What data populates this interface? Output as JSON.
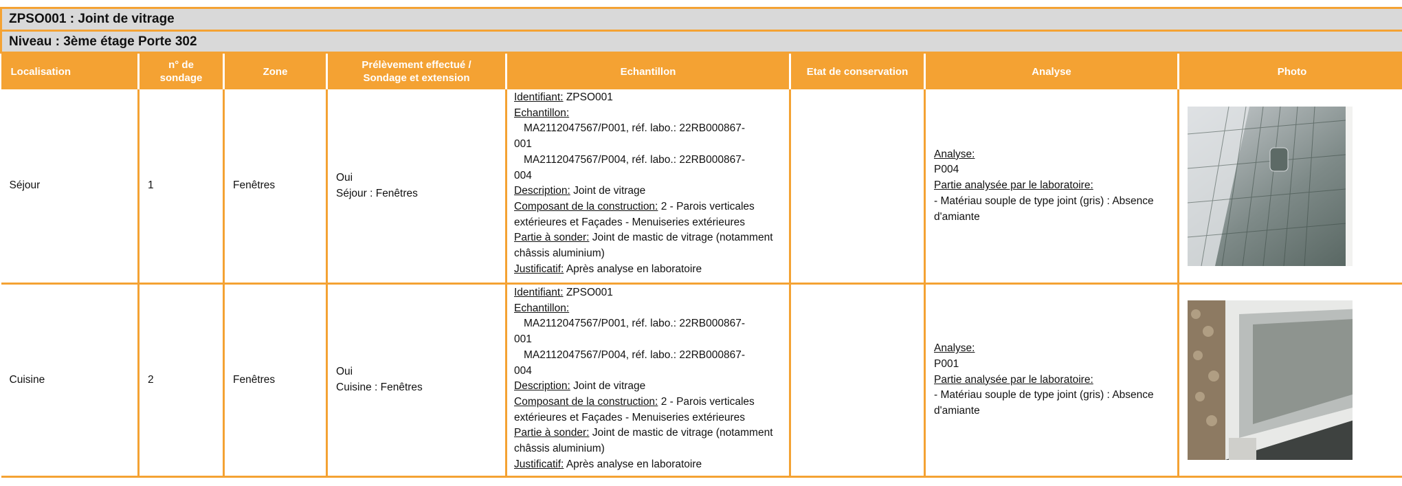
{
  "title": "ZPSO001 : Joint de vitrage",
  "level": "Niveau : 3ème étage Porte 302",
  "columns": {
    "localisation": "Localisation",
    "sondage": "n° de sondage",
    "zone": "Zone",
    "prelevement": "Prélèvement effectué / Sondage et extension",
    "echantillon": "Echantillon",
    "etat": "Etat de conservation",
    "analyse": "Analyse",
    "photo": "Photo"
  },
  "labels": {
    "identifiant": "Identifiant:",
    "echantillon": "Echantillon:",
    "description": "Description:",
    "composant": "Composant de la construction:",
    "partie": "Partie à sonder:",
    "justificatif": "Justificatif:",
    "analyse": "Analyse:",
    "partie_analysee": "Partie analysée par le laboratoire:"
  },
  "rows": [
    {
      "localisation": "Séjour",
      "sondage": "1",
      "zone": "Fenêtres",
      "prelevement": "Oui",
      "prelevement_detail": "Séjour : Fenêtres",
      "identifiant": "ZPSO001",
      "sample_1a": "MA2112047567/P001, réf. labo.: 22RB000867-",
      "sample_1b": "001",
      "sample_2a": "MA2112047567/P004, réf. labo.: 22RB000867-",
      "sample_2b": "004",
      "description": "Joint de vitrage",
      "composant": "2 - Parois verticales extérieures et Façades - Menuiseries extérieures",
      "partie": "Joint de mastic de vitrage (notamment châssis aluminium)",
      "justificatif": "Après analyse en laboratoire",
      "etat": "",
      "analyse_code": "P004",
      "analyse_result": " - Matériau souple de type joint (gris) : Absence d'amiante",
      "photo": "window-photo-sejour"
    },
    {
      "localisation": "Cuisine",
      "sondage": "2",
      "zone": "Fenêtres",
      "prelevement": "Oui",
      "prelevement_detail": "Cuisine : Fenêtres",
      "identifiant": "ZPSO001",
      "sample_1a": "MA2112047567/P001, réf. labo.: 22RB000867-",
      "sample_1b": "001",
      "sample_2a": "MA2112047567/P004, réf. labo.: 22RB000867-",
      "sample_2b": "004",
      "description": "Joint de vitrage",
      "composant": "2 - Parois verticales extérieures et Façades - Menuiseries extérieures",
      "partie": "Joint de mastic de vitrage (notamment châssis aluminium)",
      "justificatif": "Après analyse en laboratoire",
      "etat": "",
      "analyse_code": "P001",
      "analyse_result": " - Matériau souple de type joint (gris) : Absence d'amiante",
      "photo": "window-photo-cuisine"
    }
  ],
  "colors": {
    "accent": "#f4a233",
    "title_bg": "#d9d9d9",
    "header_text": "#ffffff"
  }
}
